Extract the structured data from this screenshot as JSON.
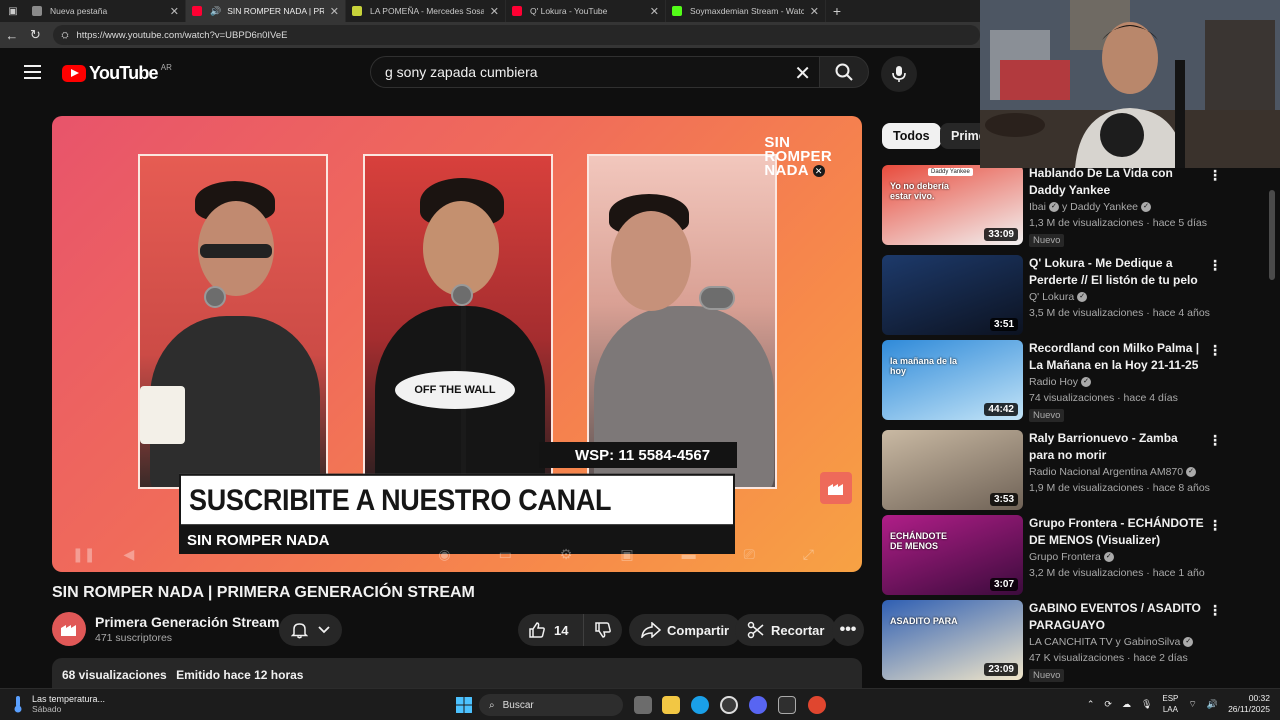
{
  "browser": {
    "tabs": [
      {
        "title": "Nueva pestaña",
        "favicon_color": "#8a8a8a",
        "active": false
      },
      {
        "title": "SIN ROMPER NADA | PRIMERA GENERACIÓN",
        "favicon_color": "#ff0033",
        "active": true
      },
      {
        "title": "LA POMEÑA - Mercedes Sosa - Le",
        "favicon_color": "#c7d23a",
        "active": false
      },
      {
        "title": "Q' Lokura - YouTube",
        "favicon_color": "#ff0033",
        "active": false
      },
      {
        "title": "Soymaxdemian Stream - Watch L",
        "favicon_color": "#53fc18",
        "active": false
      }
    ],
    "url": "https://www.youtube.com/watch?v=UBPD6n0IVeE"
  },
  "header": {
    "logo_text": "YouTube",
    "country_code": "AR",
    "search_value": "g sony zapada cumbiera"
  },
  "player": {
    "brand_line1": "SIN",
    "brand_line2": "ROMPER",
    "brand_line3": "NADA",
    "shirt_text": "OFF THE WALL",
    "whatsapp": "WSP: 11 5584-4567",
    "banner": "SUSCRIBITE A NUESTRO CANAL",
    "banner_sub": "SIN ROMPER NADA"
  },
  "video": {
    "title": "SIN ROMPER NADA | PRIMERA GENERACIÓN STREAM",
    "channel": "Primera Generación Stream",
    "subscribers": "471 suscriptores",
    "likes": "14",
    "share_label": "Compartir",
    "clip_label": "Recortar",
    "views": "68 visualizaciones",
    "streamed": "Emitido hace 12 horas"
  },
  "sidebar": {
    "chips": [
      "Todos",
      "Prime"
    ],
    "recommendations": [
      {
        "title": "Hablando De La Vida con Daddy Yankee",
        "channel": "Ibai",
        "channel_extra": "y Daddy Yankee",
        "meta": "1,3 M de visualizaciones · hace 5 días",
        "duration": "33:09",
        "badge": "Nuevo",
        "thumb_top": "#e84b3c",
        "thumb_bottom": "#f2f2f2",
        "thumb_text": "Yo no debería estar vivo.",
        "thumb_tag": "Daddy Yankee"
      },
      {
        "title": "Q' Lokura - Me Dedique a Perderte // El listón de tu pelo ...",
        "channel": "Q' Lokura",
        "channel_extra": "",
        "meta": "3,5 M de visualizaciones · hace 4 años",
        "duration": "3:51",
        "badge": "",
        "thumb_top": "#1d3a6b",
        "thumb_bottom": "#0c1220",
        "thumb_text": "",
        "thumb_tag": ""
      },
      {
        "title": "Recordland con Milko Palma | La Mañana en la Hoy 21-11-25",
        "channel": "Radio Hoy",
        "channel_extra": "",
        "meta": "74 visualizaciones · hace 4 días",
        "duration": "44:42",
        "badge": "Nuevo",
        "thumb_top": "#2f8ad9",
        "thumb_bottom": "#c3e4f7",
        "thumb_text": "la mañana de la hoy",
        "thumb_tag": ""
      },
      {
        "title": "Raly Barrionuevo - Zamba para no morir",
        "channel": "Radio Nacional Argentina AM870",
        "channel_extra": "",
        "meta": "1,9 M de visualizaciones · hace 8 años",
        "duration": "3:53",
        "badge": "",
        "thumb_top": "#c9b9a3",
        "thumb_bottom": "#6f6256",
        "thumb_text": "",
        "thumb_tag": ""
      },
      {
        "title": "Grupo Frontera - ECHÁNDOTE DE MENOS (Visualizer)",
        "channel": "Grupo Frontera",
        "channel_extra": "",
        "meta": "3,2 M de visualizaciones · hace 1 año",
        "duration": "3:07",
        "badge": "",
        "thumb_top": "#b01e88",
        "thumb_bottom": "#3b0b3c",
        "thumb_text": "ECHÁNDOTE DE MENOS",
        "thumb_tag": ""
      },
      {
        "title": "GABINO EVENTOS / ASADITO PARAGUAYO",
        "channel": "LA CANCHITA TV y GabinoSilva",
        "channel_extra": "",
        "meta": "47 K visualizaciones · hace 2 días",
        "duration": "23:09",
        "badge": "Nuevo",
        "thumb_top": "#2f5fb3",
        "thumb_bottom": "#f1e6c9",
        "thumb_text": "ASADITO PARA",
        "thumb_tag": ""
      }
    ]
  },
  "taskbar": {
    "weather_title": "Las temperatura...",
    "weather_day": "Sábado",
    "search_label": "Buscar",
    "lang_1": "ESP",
    "lang_2": "LAA",
    "time": "00:32",
    "date": "26/11/2025"
  }
}
